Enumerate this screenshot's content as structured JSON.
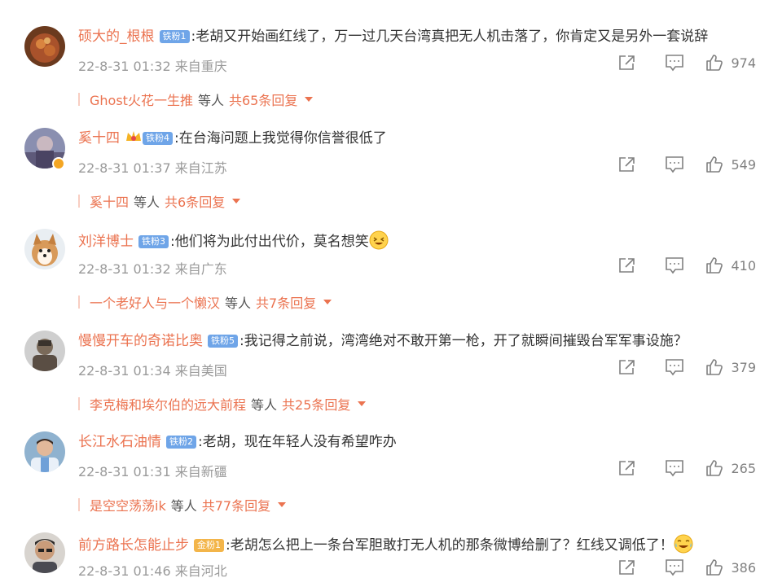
{
  "comments": [
    {
      "username": "硕大的_根根",
      "fan_badge": "铁粉1",
      "badge_type": "blue",
      "text": "老胡又开始画红线了，万一过几天台湾真把无人机击落了，你肯定又是另外一套说辞",
      "time": "22-8-31 01:32",
      "location": "来自重庆",
      "likes": "974",
      "reply_user": "Ghost火花一生推",
      "reply_mid": "等人",
      "reply_total": "共65条回复"
    },
    {
      "username": "奚十四",
      "fan_badge": "铁粉4",
      "badge_type": "blue",
      "crown": true,
      "verified": true,
      "text": "在台海问题上我觉得你信誉很低了",
      "time": "22-8-31 01:37",
      "location": "来自江苏",
      "likes": "549",
      "reply_user": "奚十四",
      "reply_mid": "等人",
      "reply_total": "共6条回复"
    },
    {
      "username": "刘洋博士",
      "fan_badge": "铁粉3",
      "badge_type": "blue",
      "text": "他们将为此付出代价，莫名想笑",
      "emoji": "laugh-emoji",
      "time": "22-8-31 01:32",
      "location": "来自广东",
      "likes": "410",
      "reply_user": "一个老好人与一个懒汉",
      "reply_mid": "等人",
      "reply_total": "共7条回复"
    },
    {
      "username": "慢慢开车的奇诺比奥",
      "fan_badge": "铁粉5",
      "badge_type": "blue",
      "text": "我记得之前说，湾湾绝对不敢开第一枪，开了就瞬间摧毁台军军事设施？",
      "time": "22-8-31 01:34",
      "location": "来自美国",
      "likes": "379",
      "reply_user": "李克梅和埃尔伯的远大前程",
      "reply_mid": "等人",
      "reply_total": "共25条回复"
    },
    {
      "username": "长江水石油情",
      "fan_badge": "铁粉2",
      "badge_type": "blue",
      "text": "老胡，现在年轻人没有希望咋办",
      "time": "22-8-31 01:31",
      "location": "来自新疆",
      "likes": "265",
      "reply_user": "是空空荡荡ik",
      "reply_mid": "等人",
      "reply_total": "共77条回复"
    },
    {
      "username": "前方路长怎能止步",
      "fan_badge": "金粉1",
      "badge_type": "gold",
      "text": "老胡怎么把上一条台军胆敢打无人机的那条微博给删了？红线又调低了！",
      "emoji": "laugh-cry-emoji",
      "time": "22-8-31 01:46",
      "location": "来自河北",
      "likes": "386"
    }
  ],
  "colors": {
    "accent": "#eb7350",
    "badge_blue": "#6fa5e8",
    "badge_gold": "#f3b54a",
    "meta_gray": "#9a9a9a"
  }
}
